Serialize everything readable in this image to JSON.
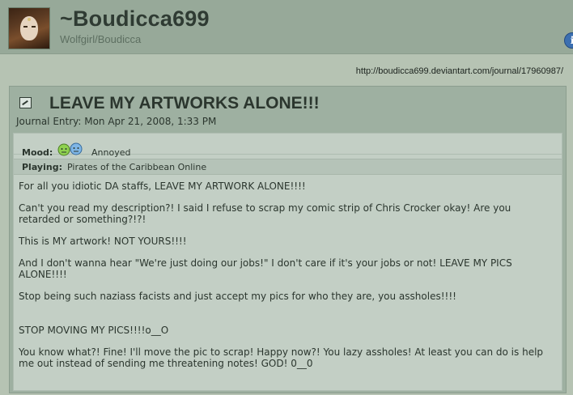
{
  "header": {
    "username": "~Boudicca699",
    "subtitle": "Wolfgirl/Boudicca",
    "info_icon": "i"
  },
  "url": "http://boudicca699.deviantart.com/journal/17960987/",
  "entry": {
    "title": "LEAVE MY ARTWORKS ALONE!!!",
    "date": "Journal Entry: Mon Apr 21, 2008, 1:33 PM",
    "mood_label": "Mood:",
    "mood_value": "Annoyed",
    "playing_label": "Playing:",
    "playing_value": "Pirates of the Caribbean Online",
    "paragraphs": [
      "For all you idiotic DA staffs, LEAVE MY ARTWORK ALONE!!!!",
      "Can't you read my description?! I said I refuse to scrap my comic strip of Chris Crocker okay! Are you retarded or something?!?!",
      "This is MY artwork! NOT YOURS!!!!",
      "And I don't wanna hear \"We're just doing our jobs!\" I don't care if it's your jobs or not! LEAVE MY PICS ALONE!!!!",
      "Stop being such naziass facists and just accept my pics for who they are, you assholes!!!!",
      "STOP MOVING MY PICS!!!!o__O",
      "You know what?! Fine! I'll move the pic to scrap! Happy now?! You lazy assholes! At least you can do is help me out instead of sending me threatening notes! GOD! 0__0"
    ]
  }
}
